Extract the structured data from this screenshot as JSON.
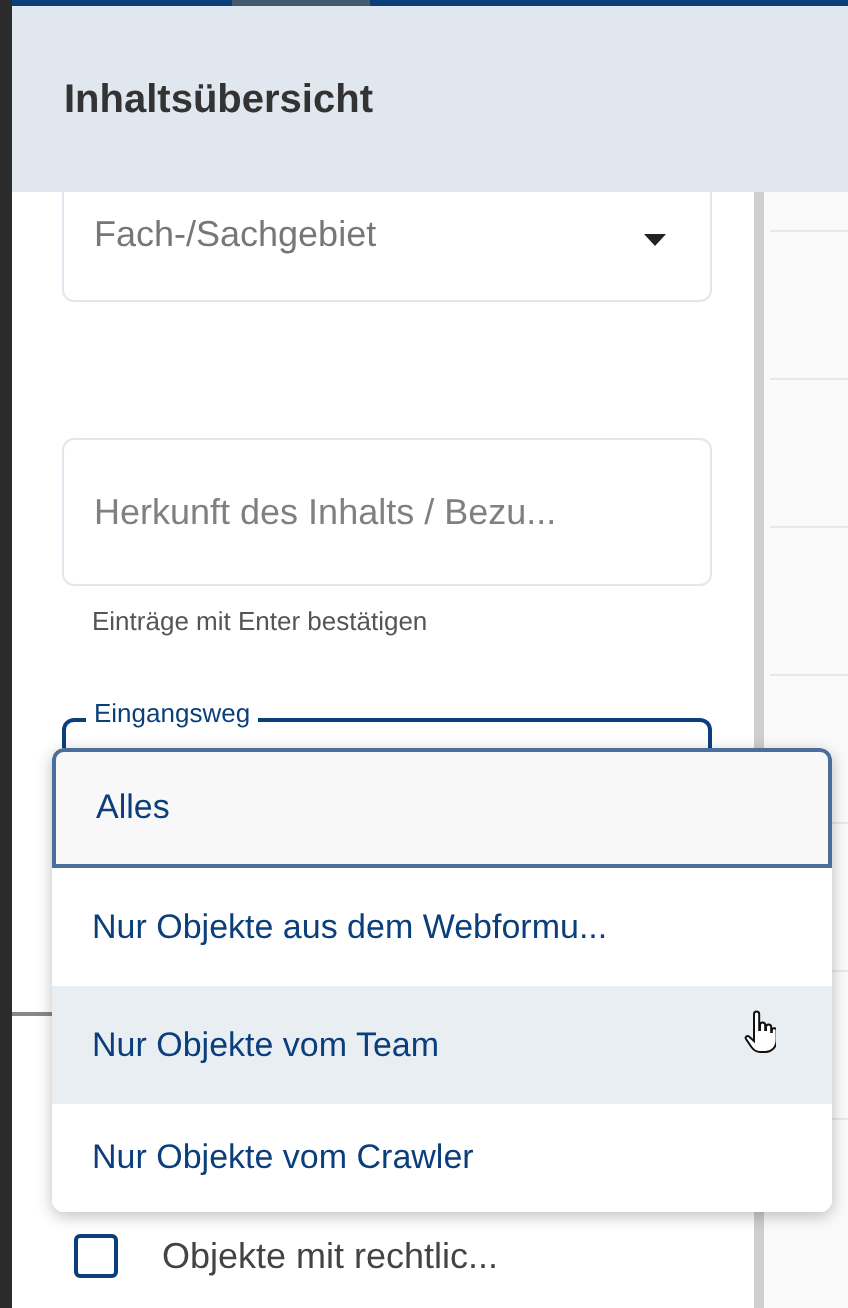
{
  "header": {
    "title": "Inhaltsübersicht"
  },
  "filters": [
    {
      "kind": "select",
      "placeholder": "Fach-/Sachgebiet"
    },
    {
      "kind": "input",
      "placeholder": "Herkunft des Inhalts / Bezu...",
      "helper": "Einträge mit Enter bestätigen"
    },
    {
      "kind": "outlined",
      "label": "Eingangsweg"
    }
  ],
  "dropdown": {
    "options": [
      {
        "label": "Alles",
        "selected": true,
        "highlighted": false
      },
      {
        "label": "Nur Objekte aus dem Webformu...",
        "selected": false,
        "highlighted": false
      },
      {
        "label": "Nur Objekte vom Team",
        "selected": false,
        "highlighted": true
      },
      {
        "label": "Nur Objekte vom Crawler",
        "selected": false,
        "highlighted": false
      }
    ]
  },
  "checkbox": {
    "label": "Objekte mit rechtlic...",
    "checked": false
  }
}
